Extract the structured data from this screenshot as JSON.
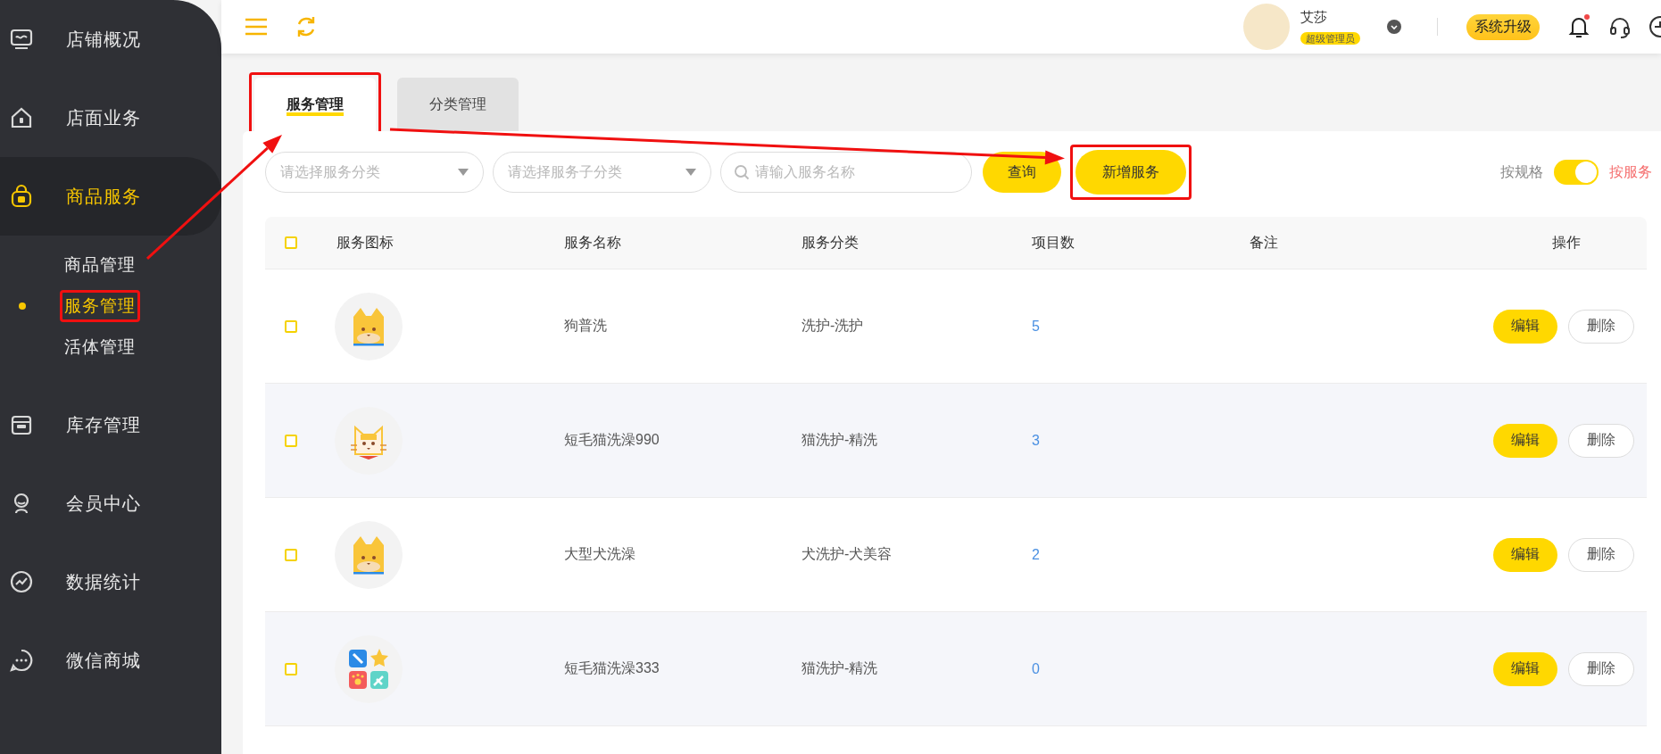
{
  "sidebar": {
    "items": [
      {
        "label": "店铺概况",
        "selected": false
      },
      {
        "label": "店面业务",
        "selected": false
      },
      {
        "label": "商品服务",
        "selected": true,
        "expanded": true,
        "children": [
          {
            "label": "商品管理",
            "selected": false,
            "highlighted": false
          },
          {
            "label": "服务管理",
            "selected": true,
            "highlighted": true
          },
          {
            "label": "活体管理",
            "selected": false,
            "highlighted": false
          }
        ]
      },
      {
        "label": "库存管理",
        "selected": false
      },
      {
        "label": "会员中心",
        "selected": false
      },
      {
        "label": "数据统计",
        "selected": false
      },
      {
        "label": "微信商城",
        "selected": false
      }
    ]
  },
  "header": {
    "user_name": "艾莎",
    "role_badge": "超级管理员",
    "upgrade_button": "系统升级",
    "notification_unread": true
  },
  "tabs": [
    {
      "label": "服务管理",
      "selected": true,
      "highlighted": true
    },
    {
      "label": "分类管理",
      "selected": false,
      "highlighted": false
    }
  ],
  "filters": {
    "category_placeholder": "请选择服务分类",
    "subcategory_placeholder": "请选择服务子分类",
    "search_placeholder": "请输入服务名称",
    "query_button": "查询",
    "add_button": {
      "label": "新增服务",
      "highlighted": true
    },
    "toggle": {
      "left_label": "按规格",
      "right_label": "按服务",
      "on": true
    }
  },
  "table": {
    "all_checked": false,
    "columns": [
      "服务图标",
      "服务名称",
      "服务分类",
      "项目数",
      "备注",
      "操作"
    ],
    "rows": [
      {
        "checked": false,
        "kind": "dog",
        "name": "狗普洗",
        "category": "洗护-洗护",
        "count": "5",
        "actions": [
          "编辑",
          "删除"
        ]
      },
      {
        "checked": false,
        "kind": "cat",
        "name": "短毛猫洗澡990",
        "category": "猫洗护-精洗",
        "count": "3",
        "actions": [
          "编辑",
          "删除"
        ]
      },
      {
        "checked": false,
        "kind": "dog",
        "name": "大型犬洗澡",
        "category": "犬洗护-犬美容",
        "count": "2",
        "actions": [
          "编辑",
          "删除"
        ]
      },
      {
        "checked": false,
        "kind": "grid",
        "name": "短毛猫洗澡333",
        "category": "猫洗护-精洗",
        "count": "0",
        "actions": [
          "编辑",
          "删除"
        ]
      }
    ]
  },
  "annotations": {
    "arrow_menu_to_tab": true,
    "arrow_tab_to_add_button": true
  }
}
